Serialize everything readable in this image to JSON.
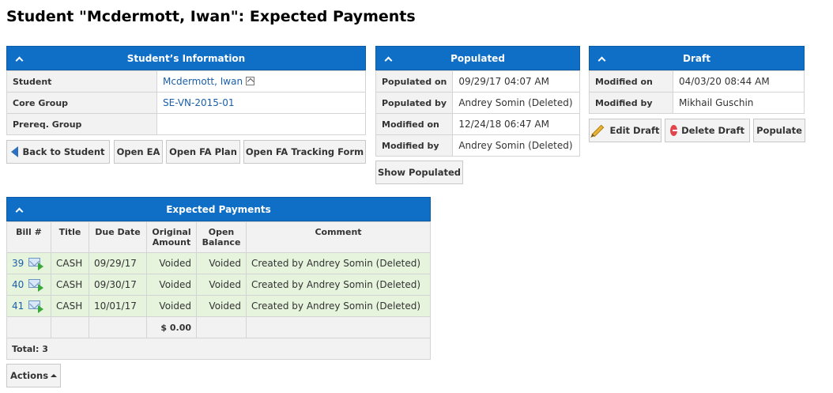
{
  "page": {
    "title": "Student \"Mcdermott, Iwan\": Expected Payments"
  },
  "student_info": {
    "header": "Student’s Information",
    "rows": [
      {
        "label": "Student",
        "value": "Mcdermott, Iwan"
      },
      {
        "label": "Core Group",
        "value": "SE-VN-2015-01"
      },
      {
        "label": "Prereq. Group",
        "value": ""
      }
    ],
    "buttons": {
      "back": "Back to Student",
      "open_ea": "Open EA",
      "open_fa_plan": "Open FA Plan",
      "open_fa_tracking": "Open FA Tracking Form"
    }
  },
  "populated": {
    "header": "Populated",
    "rows": [
      {
        "label": "Populated on",
        "value": "09/29/17 04:07 AM"
      },
      {
        "label": "Populated by",
        "value": "Andrey Somin (Deleted)"
      },
      {
        "label": "Modified on",
        "value": "12/24/18 06:47 AM"
      },
      {
        "label": "Modified by",
        "value": "Andrey Somin (Deleted)"
      }
    ],
    "show_button": "Show Populated"
  },
  "draft": {
    "header": "Draft",
    "rows": [
      {
        "label": "Modified on",
        "value": "04/03/20 08:44 AM"
      },
      {
        "label": "Modified by",
        "value": "Mikhail Guschin"
      }
    ],
    "buttons": {
      "edit": "Edit Draft",
      "delete": "Delete Draft",
      "populate": "Populate"
    }
  },
  "payments": {
    "header": "Expected Payments",
    "columns": {
      "bill": "Bill #",
      "title": "Title",
      "due": "Due Date",
      "original_l1": "Original",
      "original_l2": "Amount",
      "open_l1": "Open",
      "open_l2": "Balance",
      "comment": "Comment"
    },
    "rows": [
      {
        "bill": "39",
        "title": "CASH",
        "due": "09/29/17",
        "original": "Voided",
        "open": "Voided",
        "comment": "Created by Andrey Somin (Deleted)"
      },
      {
        "bill": "40",
        "title": "CASH",
        "due": "09/30/17",
        "original": "Voided",
        "open": "Voided",
        "comment": "Created by Andrey Somin (Deleted)"
      },
      {
        "bill": "41",
        "title": "CASH",
        "due": "10/01/17",
        "original": "Voided",
        "open": "Voided",
        "comment": "Created by Andrey Somin (Deleted)"
      }
    ],
    "original_total": "$ 0.00",
    "footer": "Total: 3",
    "actions": "Actions"
  }
}
